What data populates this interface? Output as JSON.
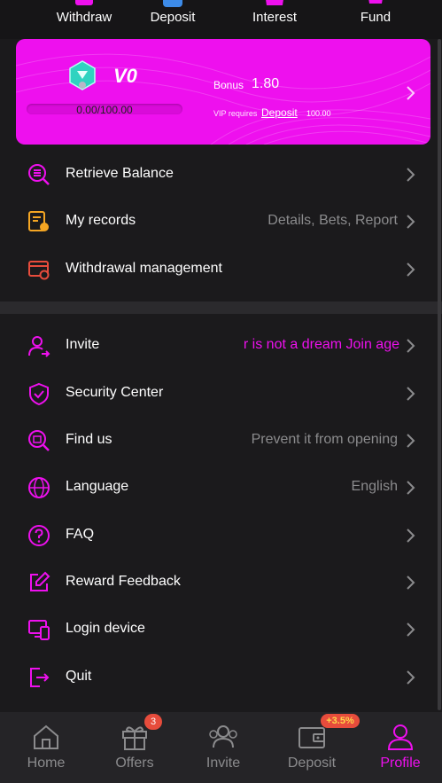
{
  "top_actions": [
    {
      "label": "Withdraw",
      "icon": "withdraw-icon"
    },
    {
      "label": "Deposit",
      "icon": "deposit-icon"
    },
    {
      "label": "Interest",
      "icon": "interest-icon"
    },
    {
      "label": "Fund",
      "icon": "fund-icon"
    }
  ],
  "vip": {
    "level": "V0",
    "progress_text": "0.00/100.00",
    "progress_fraction": 0,
    "bonus_label": "Bonus",
    "bonus_value": "1.80",
    "requires_text": "VIP requires",
    "requires_link": "Deposit",
    "requires_amount": "100.00"
  },
  "menu_group1": [
    {
      "label": "Retrieve Balance",
      "value": "",
      "icon": "retrieve-balance-icon"
    },
    {
      "label": "My records",
      "value": "Details, Bets, Report",
      "icon": "records-icon"
    },
    {
      "label": "Withdrawal management",
      "value": "",
      "icon": "withdrawal-management-icon"
    }
  ],
  "menu_group2": [
    {
      "label": "Invite",
      "value": "r is not a dream  Join age",
      "icon": "invite-icon"
    },
    {
      "label": "Security Center",
      "value": "",
      "icon": "shield-icon"
    },
    {
      "label": "Find us",
      "value": "Prevent it from opening",
      "icon": "find-us-icon"
    },
    {
      "label": "Language",
      "value": "English",
      "icon": "globe-icon"
    },
    {
      "label": "FAQ",
      "value": "",
      "icon": "question-icon"
    },
    {
      "label": "Reward Feedback",
      "value": "",
      "icon": "edit-icon"
    },
    {
      "label": "Login device",
      "value": "",
      "icon": "device-icon"
    },
    {
      "label": "Quit",
      "value": "",
      "icon": "logout-icon"
    }
  ],
  "bottom_nav": [
    {
      "label": "Home",
      "icon": "home-icon"
    },
    {
      "label": "Offers",
      "icon": "gift-icon",
      "badge": "3"
    },
    {
      "label": "Invite",
      "icon": "people-icon"
    },
    {
      "label": "Deposit",
      "icon": "wallet-icon",
      "badge": "+3.5%"
    },
    {
      "label": "Profile",
      "icon": "profile-icon",
      "active": true
    }
  ],
  "colors": {
    "accent": "#ee10ee",
    "background": "#1b1a1c",
    "muted_text": "#8b8b8d",
    "badge": "#e74c3c"
  }
}
